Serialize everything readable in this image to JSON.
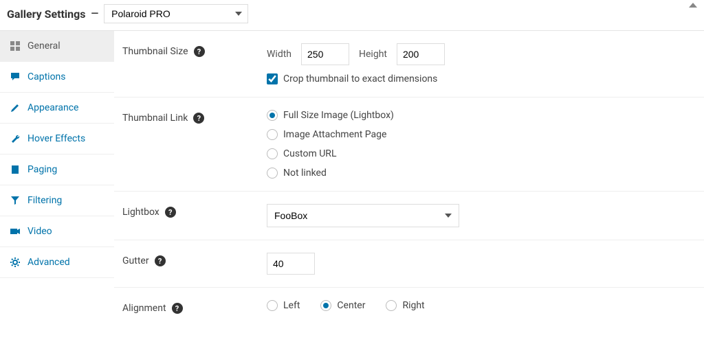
{
  "header": {
    "title": "Gallery Settings",
    "template": "Polaroid PRO"
  },
  "sidebar": {
    "items": [
      {
        "key": "general",
        "label": "General",
        "active": true
      },
      {
        "key": "captions",
        "label": "Captions"
      },
      {
        "key": "appearance",
        "label": "Appearance"
      },
      {
        "key": "hover",
        "label": "Hover Effects"
      },
      {
        "key": "paging",
        "label": "Paging"
      },
      {
        "key": "filtering",
        "label": "Filtering"
      },
      {
        "key": "video",
        "label": "Video"
      },
      {
        "key": "advanced",
        "label": "Advanced"
      }
    ]
  },
  "settings": {
    "thumb_size": {
      "label": "Thumbnail Size",
      "width_label": "Width",
      "width": "250",
      "height_label": "Height",
      "height": "200",
      "crop_label": "Crop thumbnail to exact dimensions",
      "crop_checked": true
    },
    "thumb_link": {
      "label": "Thumbnail Link",
      "options": [
        {
          "label": "Full Size Image (Lightbox)",
          "checked": true
        },
        {
          "label": "Image Attachment Page",
          "checked": false
        },
        {
          "label": "Custom URL",
          "checked": false
        },
        {
          "label": "Not linked",
          "checked": false
        }
      ]
    },
    "lightbox": {
      "label": "Lightbox",
      "value": "FooBox"
    },
    "gutter": {
      "label": "Gutter",
      "value": "40"
    },
    "alignment": {
      "label": "Alignment",
      "options": [
        {
          "label": "Left",
          "checked": false
        },
        {
          "label": "Center",
          "checked": true
        },
        {
          "label": "Right",
          "checked": false
        }
      ]
    }
  }
}
